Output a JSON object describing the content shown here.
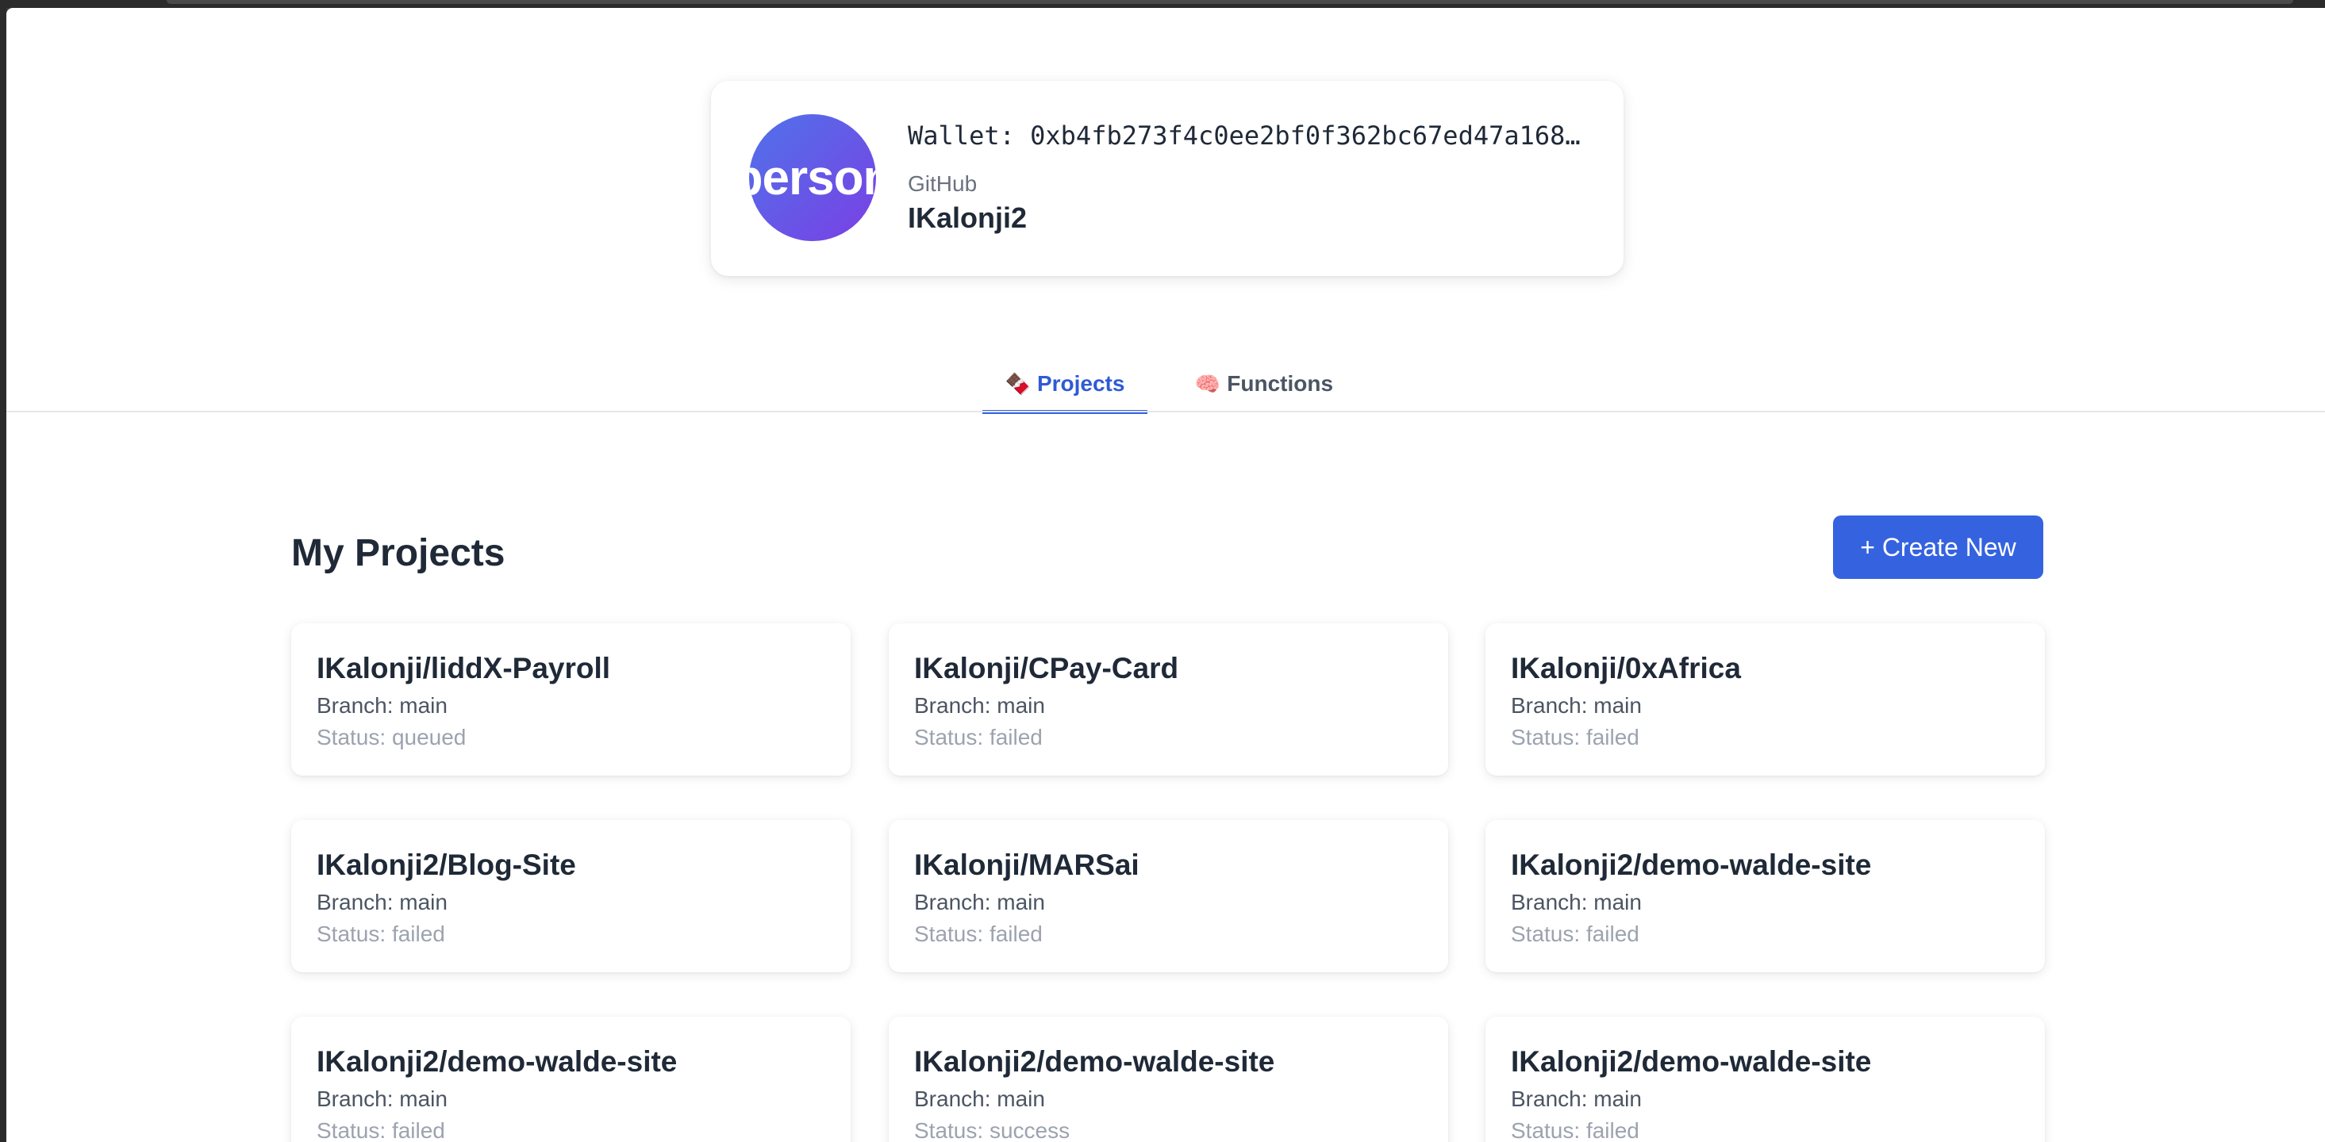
{
  "profile": {
    "avatar_text": "person",
    "wallet": "Wallet: 0xb4fb273f4c0ee2bf0f362bc67ed47a168…",
    "provider_label": "GitHub",
    "username": "IKalonji2"
  },
  "tabs": [
    {
      "icon": "🍫",
      "label": "Projects",
      "active": true
    },
    {
      "icon": "🧠",
      "label": "Functions",
      "active": false
    }
  ],
  "projects": {
    "title": "My Projects",
    "create_label": "+ Create New",
    "items": [
      {
        "name": "IKalonji/liddX-Payroll",
        "branch": "Branch: main",
        "status": "Status: queued"
      },
      {
        "name": "IKalonji/CPay-Card",
        "branch": "Branch: main",
        "status": "Status: failed"
      },
      {
        "name": "IKalonji/0xAfrica",
        "branch": "Branch: main",
        "status": "Status: failed"
      },
      {
        "name": "IKalonji2/Blog-Site",
        "branch": "Branch: main",
        "status": "Status: failed"
      },
      {
        "name": "IKalonji/MARSai",
        "branch": "Branch: main",
        "status": "Status: failed"
      },
      {
        "name": "IKalonji2/demo-walde-site",
        "branch": "Branch: main",
        "status": "Status: failed"
      },
      {
        "name": "IKalonji2/demo-walde-site",
        "branch": "Branch: main",
        "status": "Status: failed"
      },
      {
        "name": "IKalonji2/demo-walde-site",
        "branch": "Branch: main",
        "status": "Status: success"
      },
      {
        "name": "IKalonji2/demo-walde-site",
        "branch": "Branch: main",
        "status": "Status: failed"
      }
    ]
  },
  "colors": {
    "accent": "#3563e0",
    "avatar_gradient_start": "#4f73ea",
    "avatar_gradient_end": "#7b3fe4"
  }
}
